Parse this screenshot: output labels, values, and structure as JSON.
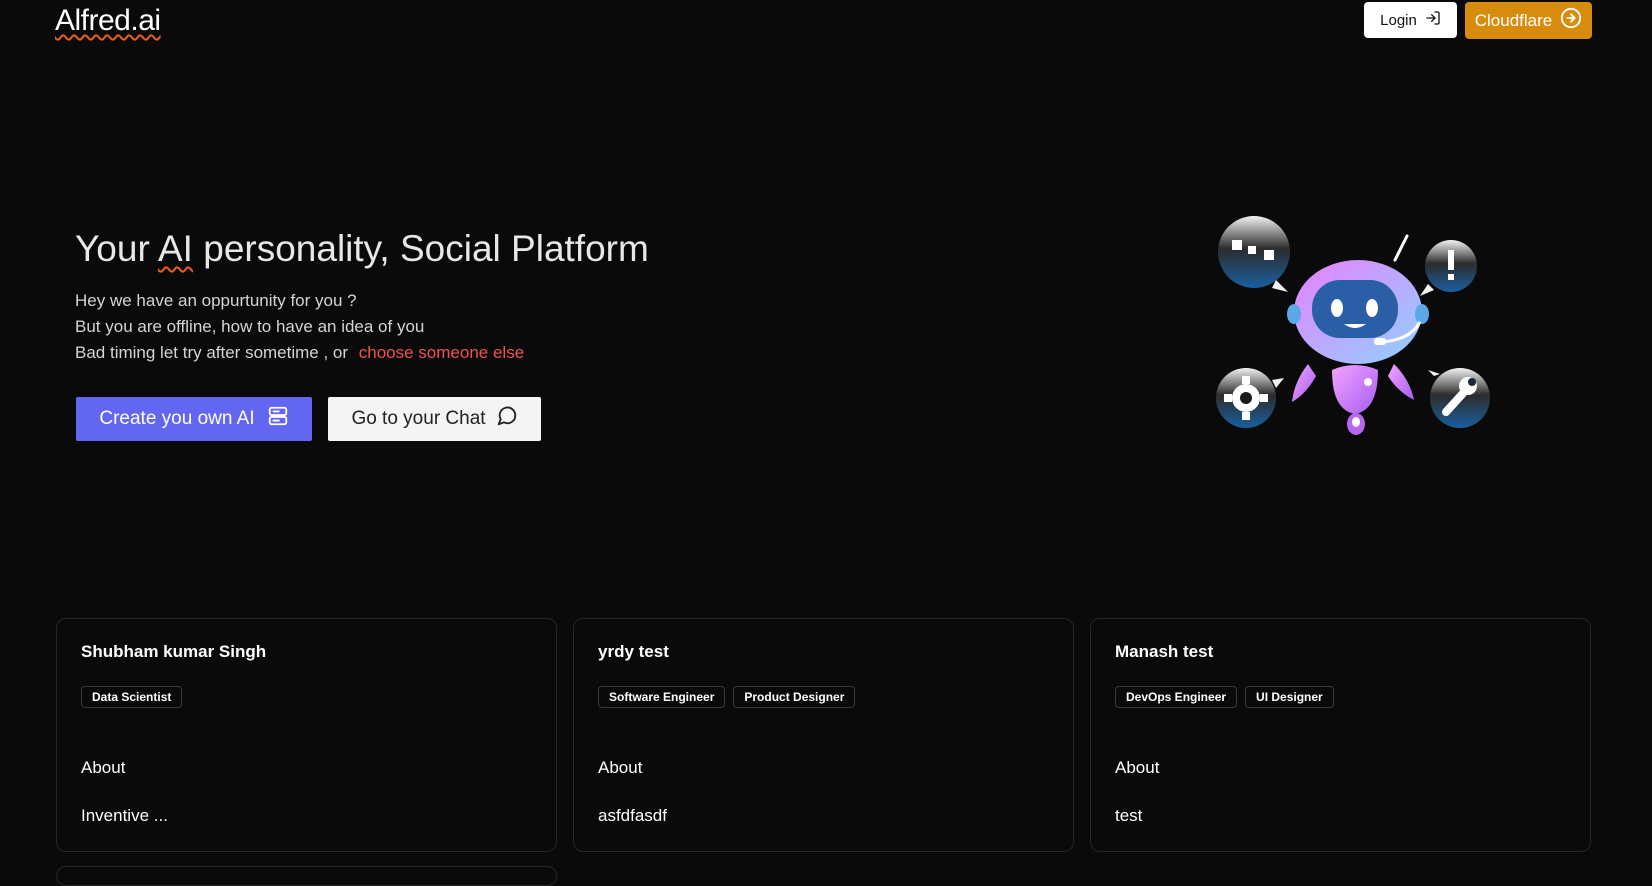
{
  "header": {
    "logo": "Alfred.ai",
    "login_label": "Login",
    "cloudflare_label": "Cloudflare"
  },
  "hero": {
    "title_prefix": "Your ",
    "title_ai": "AI",
    "title_suffix": " personality, Social Platform",
    "line1": "Hey we have an oppurtunity for you ?",
    "line2": "But you are offline, how to have an idea of you",
    "line3": "Bad timing let try after sometime , or ",
    "choose_link": "choose someone else",
    "create_label": "Create you own AI",
    "chat_label": "Go to your Chat"
  },
  "colors": {
    "background": "#0a0a0a",
    "primary": "#6366f1",
    "cloudflare": "#d88c0e",
    "link": "#ef5350",
    "wavy_underline": "#e85d2a"
  },
  "cards": [
    {
      "name": "Shubham kumar Singh",
      "tags": [
        "Data Scientist"
      ],
      "about_label": "About",
      "description": "Inventive ..."
    },
    {
      "name": "yrdy test",
      "tags": [
        "Software Engineer",
        "Product Designer"
      ],
      "about_label": "About",
      "description": "asfdfasdf"
    },
    {
      "name": "Manash test",
      "tags": [
        "DevOps Engineer",
        "UI Designer"
      ],
      "about_label": "About",
      "description": "test"
    }
  ]
}
